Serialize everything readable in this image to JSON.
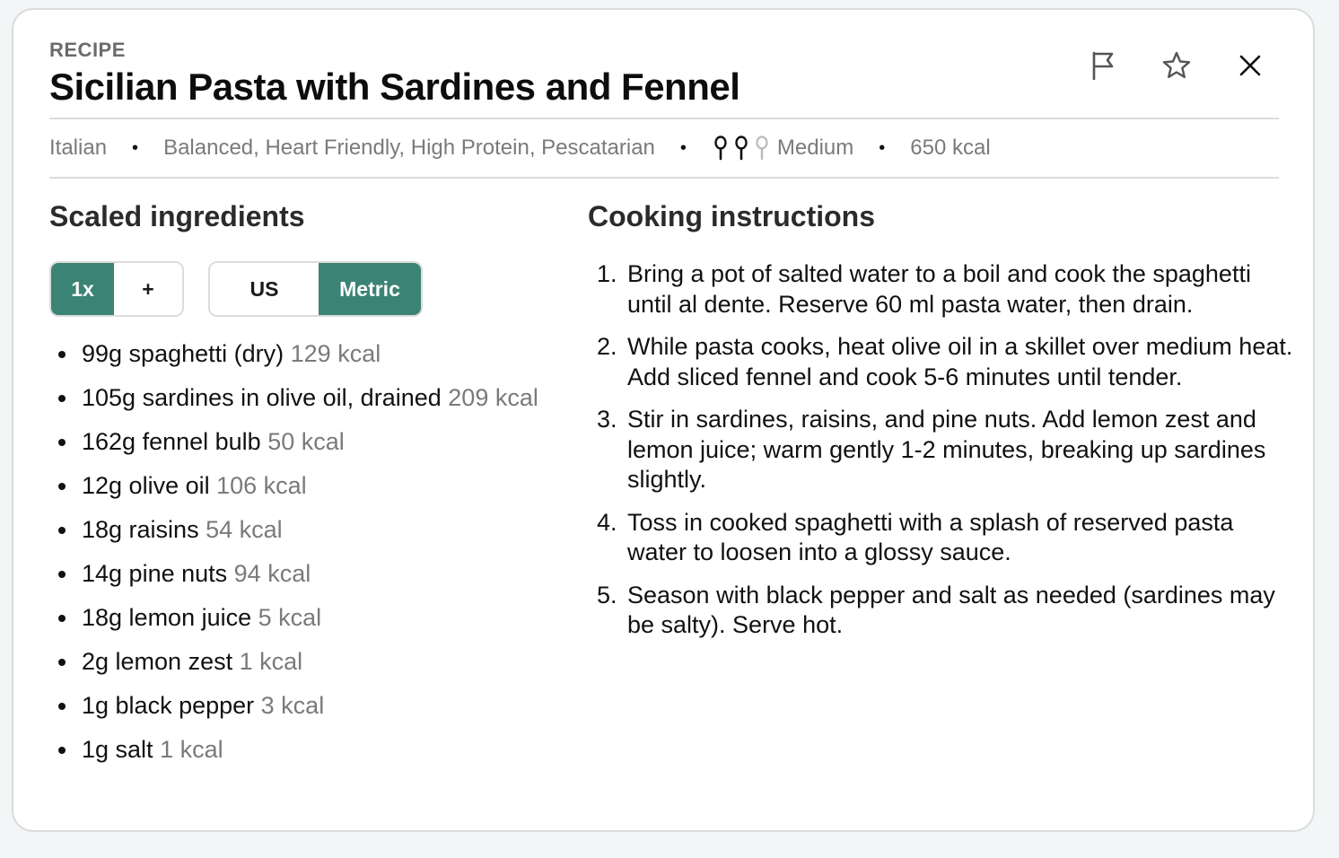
{
  "header": {
    "kicker": "RECIPE",
    "title": "Sicilian Pasta with Sardines and Fennel"
  },
  "actions": [
    {
      "icon": "flag-icon",
      "label": "Report"
    },
    {
      "icon": "star-icon",
      "label": "Favorite"
    },
    {
      "icon": "close-icon",
      "label": "Close"
    }
  ],
  "meta": {
    "cuisine": "Italian",
    "diets": "Balanced, Heart Friendly, High Protein, Pescatarian",
    "difficulty_label": "Medium",
    "difficulty_level": 2,
    "difficulty_max": 3,
    "calories": "650 kcal",
    "separator": "•"
  },
  "ingredients_section": {
    "heading": "Scaled ingredients",
    "scale_options": [
      "1x",
      "+"
    ],
    "scale_selected": "1x",
    "unit_options": [
      "US",
      "Metric"
    ],
    "unit_selected": "Metric",
    "items": [
      {
        "text": "99g spaghetti (dry)",
        "kcal": "129 kcal"
      },
      {
        "text": "105g sardines in olive oil, drained",
        "kcal": "209 kcal"
      },
      {
        "text": "162g fennel bulb",
        "kcal": "50 kcal"
      },
      {
        "text": "12g olive oil",
        "kcal": "106 kcal"
      },
      {
        "text": "18g raisins",
        "kcal": "54 kcal"
      },
      {
        "text": "14g pine nuts",
        "kcal": "94 kcal"
      },
      {
        "text": "18g lemon juice",
        "kcal": "5 kcal"
      },
      {
        "text": "2g lemon zest",
        "kcal": "1 kcal"
      },
      {
        "text": "1g black pepper",
        "kcal": "3 kcal"
      },
      {
        "text": "1g salt",
        "kcal": "1 kcal"
      }
    ]
  },
  "instructions_section": {
    "heading": "Cooking instructions",
    "steps": [
      {
        "num": "1.",
        "text": "Bring a pot of salted water to a boil and cook the spaghetti until al dente. Reserve 60 ml pasta water, then drain."
      },
      {
        "num": "2.",
        "text": "While pasta cooks, heat olive oil in a skillet over medium heat. Add sliced fennel and cook 5-6 minutes until tender."
      },
      {
        "num": "3.",
        "text": "Stir in sardines, raisins, and pine nuts. Add lemon zest and lemon juice; warm gently 1-2 minutes, breaking up sardines slightly."
      },
      {
        "num": "4.",
        "text": "Toss in cooked spaghetti with a splash of reserved pasta water to loosen into a glossy sauce."
      },
      {
        "num": "5.",
        "text": "Season with black pepper and salt as needed (sardines may be salty). Serve hot."
      }
    ]
  },
  "colors": {
    "accent": "#3b8374",
    "muted_text": "#7a7a7a",
    "border": "#dcdcdc"
  }
}
